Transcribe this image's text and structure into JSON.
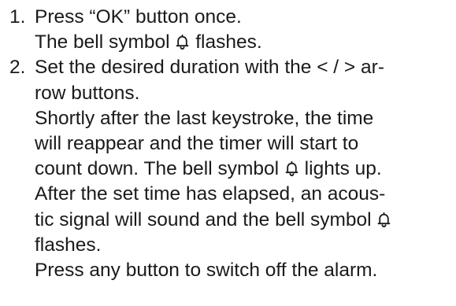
{
  "steps": [
    {
      "number": "1.",
      "lines": [
        [
          "Press “OK” button once."
        ],
        [
          "The bell symbol ",
          "bell",
          " flashes."
        ]
      ]
    },
    {
      "number": "2.",
      "lines": [
        [
          "Set the desired duration with the < / > ar-"
        ],
        [
          "row buttons."
        ],
        [
          "Shortly after the last keystroke, the time"
        ],
        [
          "will reappear and the timer will start to"
        ],
        [
          "count down. The bell symbol ",
          "bell",
          " lights up."
        ],
        [
          "After the set time has elapsed, an acous-"
        ],
        [
          "tic signal will sound and the bell symbol ",
          "bell"
        ],
        [
          "flashes."
        ],
        [
          "Press any button to switch off the alarm."
        ]
      ]
    }
  ],
  "icons": {
    "bell": "bell-icon"
  },
  "colors": {
    "text": "#1a1a1a",
    "background": "#ffffff"
  }
}
